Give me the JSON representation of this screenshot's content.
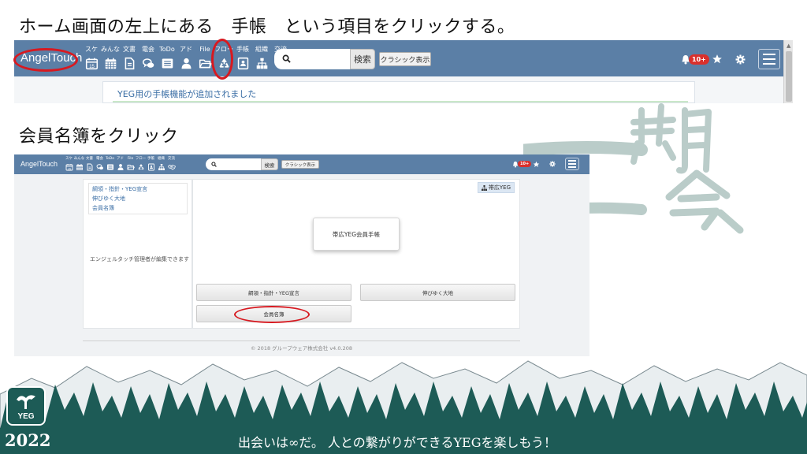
{
  "slide": {
    "heading_top": "ホーム画面の左上にある　手帳　という項目をクリックする。",
    "heading_bottom": "会員名簿をクリック",
    "banner_text": "出会いは∞だ。 人との繋がりができるYEGを楽しもう！",
    "year": "2022",
    "logo_text": "YEG",
    "calligraphy": "一期一会"
  },
  "app": {
    "brand": "AngelTouch",
    "nav": [
      {
        "label": "スケ",
        "icon": "calendar-15-icon"
      },
      {
        "label": "みんな",
        "icon": "calendar-grid-icon"
      },
      {
        "label": "文書",
        "icon": "document-icon"
      },
      {
        "label": "電会",
        "icon": "chat-bubbles-icon"
      },
      {
        "label": "ToDo",
        "icon": "list-icon"
      },
      {
        "label": "アド",
        "icon": "person-icon"
      },
      {
        "label": "File",
        "icon": "folder-icon"
      },
      {
        "label": "フロー",
        "icon": "recycle-icon"
      },
      {
        "label": "手帳",
        "icon": "notebook-icon"
      },
      {
        "label": "組織",
        "icon": "org-chart-icon"
      },
      {
        "label": "交流",
        "icon": "handshake-icon"
      }
    ],
    "search_button": "検索",
    "classic_button": "クラシック表示",
    "notification_badge": "10+",
    "info_message": "YEG用の手帳機能が追加されました"
  },
  "notebook_page": {
    "side_links": [
      "綱領・指針・YEG宣言",
      "伸びゆく大地",
      "会員名簿"
    ],
    "side_note": "エンジェルタッチ管理者が編集できます",
    "org_tag": "帯広YEG",
    "card_title": "帯広YEG会員手帳",
    "buttons": {
      "principles": "綱領・指針・YEG宣言",
      "growing_land": "伸びゆく大地",
      "member_roster": "会員名簿"
    },
    "footer": "© 2018 グループウェア株式会社 v4.0.208"
  },
  "colors": {
    "navbar": "#5b7fa6",
    "callout": "#d71920",
    "banner": "#1d5b56",
    "link": "#3a6ea5"
  }
}
